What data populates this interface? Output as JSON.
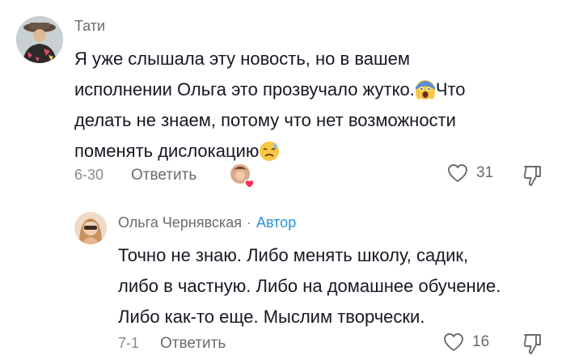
{
  "comments": [
    {
      "author": "Тати",
      "lines": [
        "Я уже слышала эту новость, но в вашем",
        "исполнении Ольга это прозвучало жутко.",
        "делать не знаем, потому что нет возможности",
        "поменять дислокацию"
      ],
      "line2_tail": "Что",
      "emoji_1": "screaming-face-emoji",
      "emoji_2": "sad-sweat-face-emoji",
      "date": "6-30",
      "reply_label": "Ответить",
      "likes": "31"
    },
    {
      "author": "Ольга Чернявская",
      "separator": "·",
      "role": "Автор",
      "lines": [
        "Точно не знаю. Либо менять школу, садик,",
        "либо в частную. Либо на домашнее обучение.",
        "Либо как-то еще. Мыслим творчески."
      ],
      "date": "7-1",
      "reply_label": "Ответить",
      "likes": "16"
    }
  ],
  "icons": {
    "like": "heart-outline-icon",
    "dislike": "thumbs-down-outline-icon",
    "creator_liked": "creator-liked-heart-icon"
  },
  "colors": {
    "author_role": "#2b90d9",
    "creator_heart": "#fe2c55",
    "muted": "#8a8a8e"
  }
}
